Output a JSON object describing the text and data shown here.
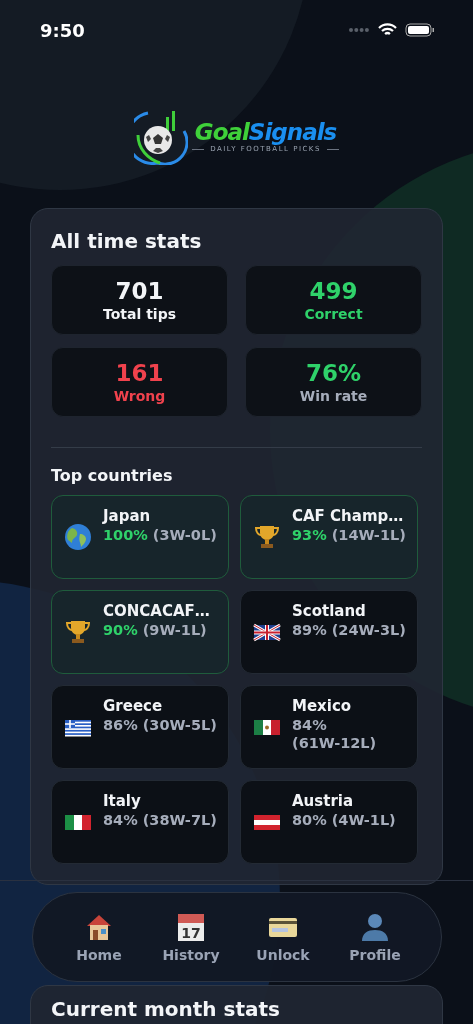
{
  "status_bar": {
    "time": "9:50"
  },
  "logo": {
    "name_part_1": "Goal",
    "name_part_2": "Signals",
    "tagline": "DAILY FOOTBALL PICKS"
  },
  "all_time_stats": {
    "title": "All time stats",
    "tiles": [
      {
        "value": "701",
        "label": "Total tips",
        "kind": "total"
      },
      {
        "value": "499",
        "label": "Correct",
        "kind": "correct"
      },
      {
        "value": "161",
        "label": "Wrong",
        "kind": "wrong"
      },
      {
        "value": "76%",
        "label": "Win rate",
        "kind": "rate"
      }
    ]
  },
  "top_countries": {
    "title": "Top countries",
    "items": [
      {
        "name": "Japan",
        "percent": "100%",
        "record": "(3W-0L)",
        "kind": "globe",
        "highlighted": true
      },
      {
        "name": "CAF Champ…",
        "percent": "93%",
        "record": "(14W-1L)",
        "kind": "trophy",
        "highlighted": true
      },
      {
        "name": "CONCACAF…",
        "percent": "90%",
        "record": "(9W-1L)",
        "kind": "trophy",
        "highlighted": true
      },
      {
        "name": "Scotland",
        "percent": "89%",
        "record": "(24W-3L)",
        "kind": "flag-uk",
        "highlighted": false
      },
      {
        "name": "Greece",
        "percent": "86%",
        "record": "(30W-5L)",
        "kind": "flag-greece",
        "highlighted": false
      },
      {
        "name": "Mexico",
        "percent": "84%",
        "record": "(61W-12L)",
        "kind": "flag-mexico",
        "highlighted": false
      },
      {
        "name": "Italy",
        "percent": "84%",
        "record": "(38W-7L)",
        "kind": "flag-italy",
        "highlighted": false
      },
      {
        "name": "Austria",
        "percent": "80%",
        "record": "(4W-1L)",
        "kind": "flag-austria",
        "highlighted": false
      }
    ]
  },
  "tab_bar": {
    "items": [
      {
        "label": "Home",
        "kind": "house",
        "selected": false
      },
      {
        "label": "History",
        "kind": "calendar",
        "calendar_day": "17",
        "selected": false
      },
      {
        "label": "Unlock",
        "kind": "card",
        "selected": false
      },
      {
        "label": "Profile",
        "kind": "person",
        "selected": false
      }
    ]
  },
  "current_month_stats": {
    "title": "Current month stats"
  }
}
